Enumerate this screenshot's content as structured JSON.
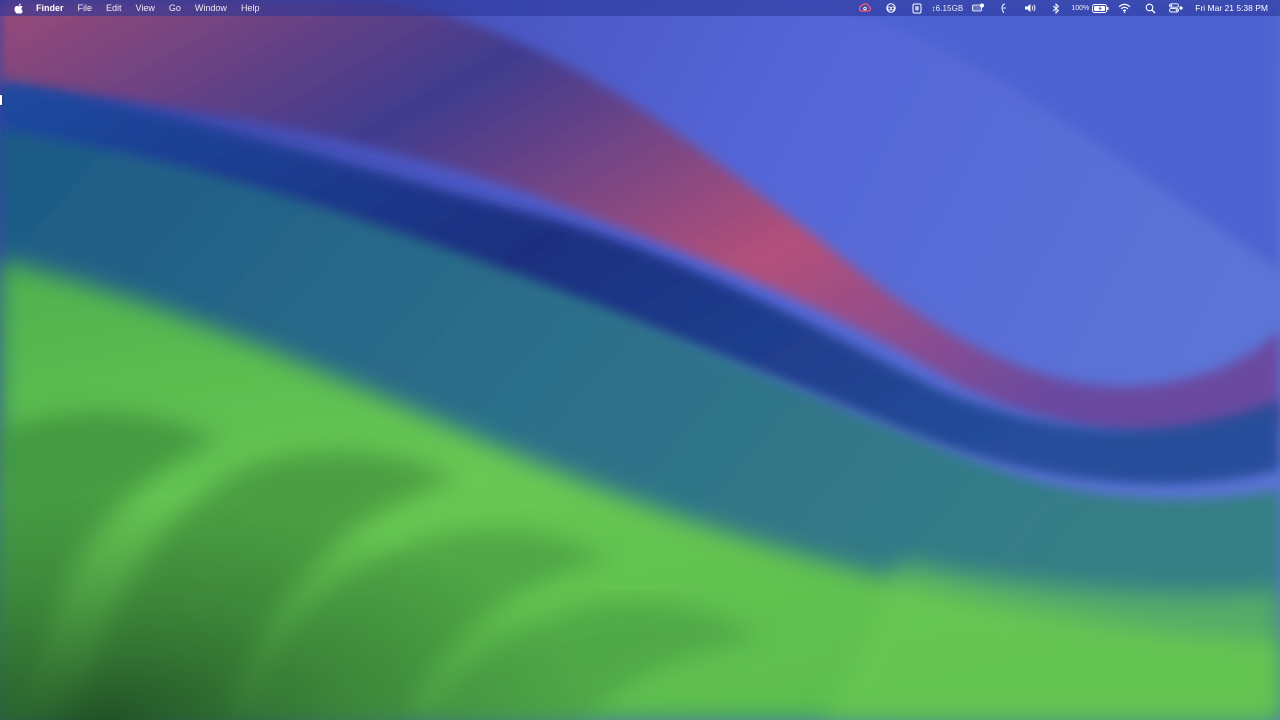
{
  "menubar": {
    "apple_icon": "apple-logo-icon",
    "app_name": "Finder",
    "menus": [
      "File",
      "Edit",
      "View",
      "Go",
      "Window",
      "Help"
    ],
    "status_icons": {
      "creative_cloud": "creative-cloud-icon",
      "sync": "sync-icon",
      "privacy": "shield-icon",
      "net_speed": "↕6.15GB",
      "focus": "focus-mode-icon",
      "accessibility": "accessibility-icon",
      "volume": "volume-icon",
      "bluetooth": "bluetooth-icon",
      "battery_percent": "100%",
      "wifi": "wifi-icon",
      "search": "spotlight-search-icon",
      "control_center": "control-center-icon"
    },
    "clock": "Fri Mar 21  5:38 PM"
  },
  "desktop": {
    "wallpaper": "macOS Sonoma wallpaper",
    "colors": {
      "green": "#66c94f",
      "deep_green": "#2f6f3a",
      "blue": "#1b3a8a",
      "violet": "#4c5bc9",
      "magenta": "#b04a74"
    }
  }
}
